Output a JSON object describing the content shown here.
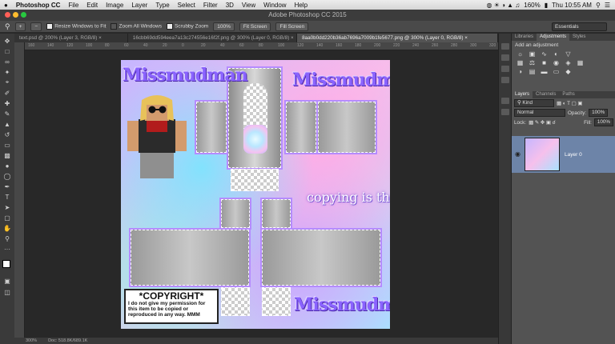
{
  "menubar": {
    "app": "Photoshop CC",
    "items": [
      "File",
      "Edit",
      "Image",
      "Layer",
      "Type",
      "Select",
      "Filter",
      "3D",
      "View",
      "Window",
      "Help"
    ],
    "battery": "160%",
    "clock": "Thu 10:55 AM"
  },
  "window": {
    "title": "Adobe Photoshop CC 2015"
  },
  "options": {
    "resize_label": "Resize Windows to Fit",
    "zoom_all_label": "Zoom All Windows",
    "scrubby_label": "Scrubby Zoom",
    "zoom_value": "100%",
    "fit_screen": "Fit Screen",
    "fill_screen": "Fill Screen",
    "workspace": "Essentials"
  },
  "tabs": [
    {
      "label": "text.psd @ 200% (Layer 3, RGB/8) ×"
    },
    {
      "label": "16cbb69dd594eea7a13c274556e16f2f.png @ 300% (Layer 0, RGB/8) ×"
    },
    {
      "label": "8aa0b0dd220b36ab7696a7009b1fe5677.png @ 300% (Layer 0, RGB/8) ×"
    }
  ],
  "ruler_marks": [
    "160",
    "140",
    "120",
    "100",
    "80",
    "60",
    "40",
    "20",
    "0",
    "20",
    "40",
    "60",
    "80",
    "100",
    "120",
    "140",
    "160",
    "180",
    "200",
    "220",
    "240",
    "260",
    "280",
    "300",
    "320"
  ],
  "canvas": {
    "brand": "Missmudman",
    "slogan": "copying is theft",
    "copyright_title": "*COPYRIGHT*",
    "copyright_body": "I do not give my permission for this item to be copied or reproduced in any way. MMM"
  },
  "status": {
    "zoom": "300%",
    "doc": "Doc: 518.8K/689.1K"
  },
  "panels": {
    "top_tabs": [
      "Libraries",
      "Adjustments",
      "Styles"
    ],
    "adj_head": "Add an adjustment",
    "layer_tabs": [
      "Layers",
      "Channels",
      "Paths"
    ],
    "kind": "Kind",
    "blend": "Normal",
    "opacity_label": "Opacity:",
    "opacity": "100%",
    "lock_label": "Lock:",
    "fill_label": "Fill:",
    "fill": "100%",
    "layer_name": "Layer 0"
  }
}
